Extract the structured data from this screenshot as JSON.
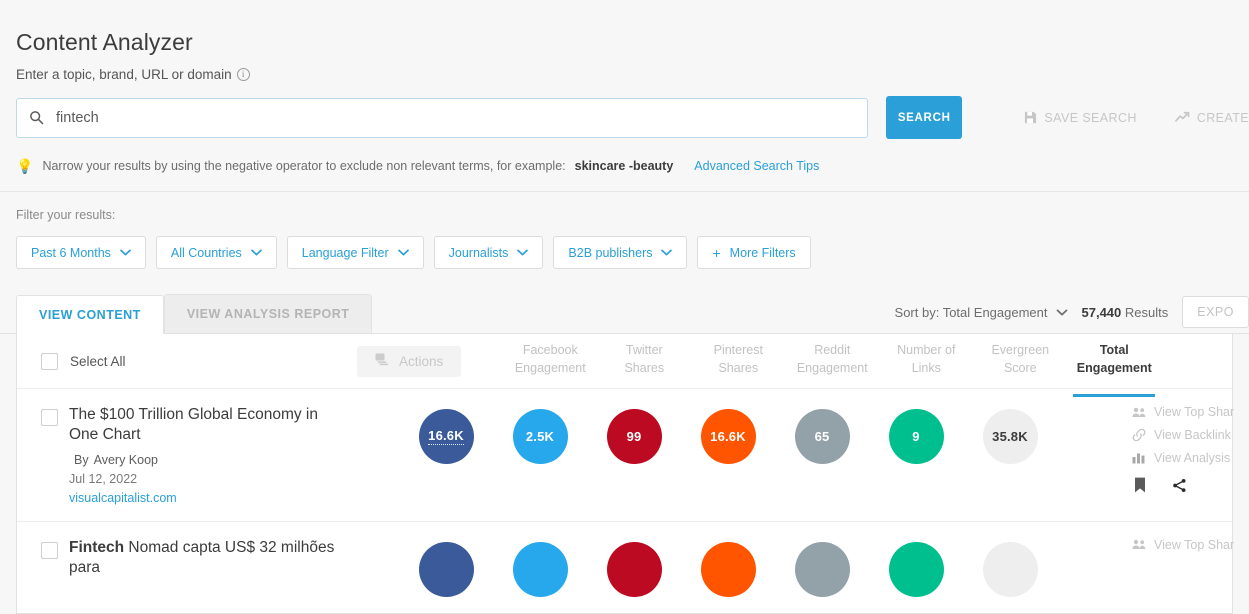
{
  "header": {
    "title": "Content Analyzer",
    "subtitle": "Enter a topic, brand, URL or domain",
    "info_icon": "info-icon"
  },
  "search": {
    "value": "fintech",
    "placeholder": "Enter a topic, brand, URL or domain",
    "button_label": "SEARCH",
    "icon": "search-icon",
    "actions": [
      {
        "label": "SAVE SEARCH",
        "icon": "save-icon"
      },
      {
        "label": "CREATE",
        "icon": "trend-arrow-icon"
      }
    ]
  },
  "tip": {
    "icon": "lightbulb-icon",
    "text_before": "Narrow your results by using the negative operator to exclude non relevant terms, for example:",
    "example": "skincare -beauty",
    "link": "Advanced Search Tips"
  },
  "filters": {
    "label": "Filter your results:",
    "chips": [
      {
        "label": "Past 6 Months",
        "icon": "chevron-down-icon"
      },
      {
        "label": "All Countries",
        "icon": "chevron-down-icon"
      },
      {
        "label": "Language Filter",
        "icon": "chevron-down-icon"
      },
      {
        "label": "Journalists",
        "icon": "chevron-down-icon"
      },
      {
        "label": "B2B publishers",
        "icon": "chevron-down-icon"
      },
      {
        "label": "More Filters",
        "icon": "plus-icon"
      }
    ]
  },
  "tabs": [
    {
      "label": "VIEW CONTENT",
      "active": true
    },
    {
      "label": "VIEW ANALYSIS REPORT",
      "active": false
    }
  ],
  "toolbar": {
    "sort_label": "Sort by: Total Engagement",
    "sort_icon": "chevron-down-icon",
    "results_count": "57,440",
    "results_label": "Results",
    "export_label": "EXPO"
  },
  "table": {
    "select_all_label": "Select All",
    "actions_label": "Actions",
    "actions_icon": "layers-icon",
    "columns": [
      {
        "line1": "Facebook",
        "line2": "Engagement",
        "active": false
      },
      {
        "line1": "Twitter",
        "line2": "Shares",
        "active": false
      },
      {
        "line1": "Pinterest",
        "line2": "Shares",
        "active": false
      },
      {
        "line1": "Reddit",
        "line2": "Engagement",
        "active": false
      },
      {
        "line1": "Number of",
        "line2": "Links",
        "active": false
      },
      {
        "line1": "Evergreen",
        "line2": "Score",
        "active": false
      },
      {
        "line1": "Total",
        "line2": "Engagement",
        "active": true
      }
    ]
  },
  "rows": [
    {
      "title_bold": "",
      "title": "The $100 Trillion Global Economy in One Chart",
      "by_label": "By",
      "author": "Avery Koop",
      "date": "Jul 12, 2022",
      "domain": "visualcapitalist.com",
      "metrics": [
        {
          "value": "16.6K",
          "color": "#3b5a9a",
          "text_color": "#ffffff",
          "dotted": true
        },
        {
          "value": "2.5K",
          "color": "#27a8ec",
          "text_color": "#ffffff",
          "dotted": false
        },
        {
          "value": "99",
          "color": "#bb0a21",
          "text_color": "#ffffff",
          "dotted": false
        },
        {
          "value": "16.6K",
          "color": "#ff5500",
          "text_color": "#ffffff",
          "dotted": false
        },
        {
          "value": "65",
          "color": "#93a1a8",
          "text_color": "#ffffff",
          "dotted": false
        },
        {
          "value": "9",
          "color": "#00bf8f",
          "text_color": "#ffffff",
          "dotted": false
        },
        {
          "value": "35.8K",
          "color": "#eeeeee",
          "text_color": "#3c3c3c",
          "dotted": false
        }
      ],
      "links": [
        {
          "label": "View Top Shar",
          "icon": "people-icon"
        },
        {
          "label": "View Backlink",
          "icon": "link-icon"
        },
        {
          "label": "View Analysis",
          "icon": "bar-chart-icon"
        }
      ],
      "icons": [
        {
          "icon": "bookmark-icon"
        },
        {
          "icon": "share-icon"
        }
      ]
    },
    {
      "title_bold": "Fintech",
      "title": " Nomad capta US$ 32 milhões para",
      "by_label": "",
      "author": "",
      "date": "",
      "domain": "",
      "metrics": [
        {
          "value": "",
          "color": "#3b5a9a",
          "text_color": "#ffffff",
          "dotted": false
        },
        {
          "value": "",
          "color": "#27a8ec",
          "text_color": "#ffffff",
          "dotted": false
        },
        {
          "value": "",
          "color": "#bb0a21",
          "text_color": "#ffffff",
          "dotted": false
        },
        {
          "value": "",
          "color": "#ff5500",
          "text_color": "#ffffff",
          "dotted": false
        },
        {
          "value": "",
          "color": "#93a1a8",
          "text_color": "#ffffff",
          "dotted": false
        },
        {
          "value": "",
          "color": "#00bf8f",
          "text_color": "#ffffff",
          "dotted": false
        },
        {
          "value": "",
          "color": "#eeeeee",
          "text_color": "#3c3c3c",
          "dotted": false
        }
      ],
      "links": [
        {
          "label": "View Top Shar",
          "icon": "people-icon"
        }
      ],
      "icons": []
    }
  ],
  "colors": {
    "accent": "#2a9fd8",
    "facebook": "#3b5a9a",
    "twitter": "#27a8ec",
    "pinterest": "#bb0a21",
    "reddit": "#ff5500",
    "links": "#93a1a8",
    "evergreen": "#00bf8f",
    "total": "#eeeeee"
  }
}
